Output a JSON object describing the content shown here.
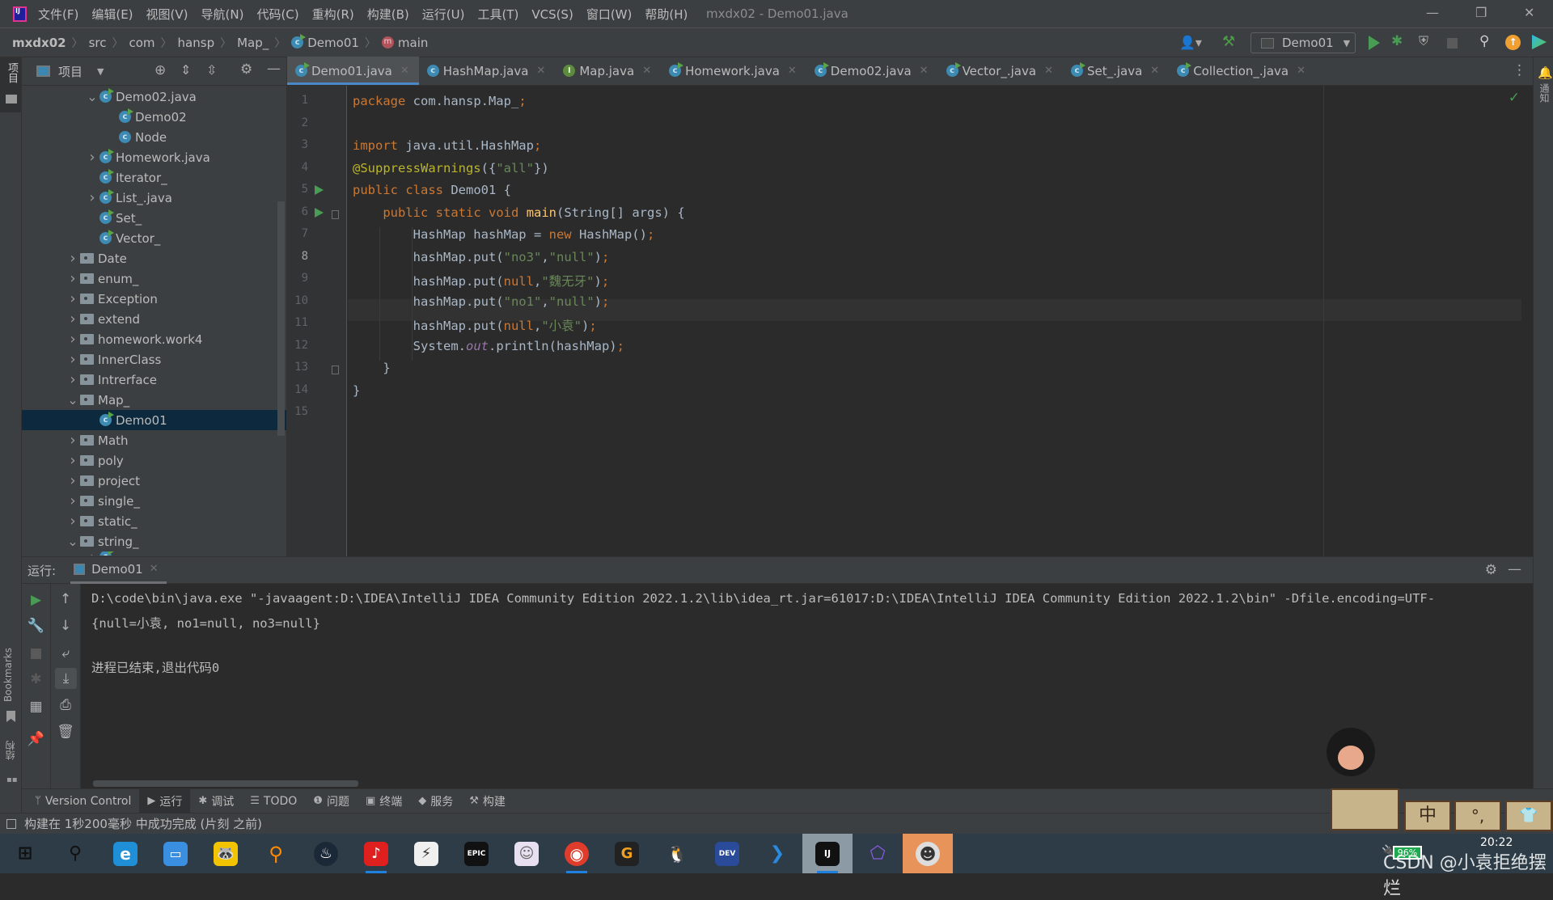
{
  "titlebar": {
    "window_title": "mxdx02 - Demo01.java",
    "menu": [
      "文件(F)",
      "编辑(E)",
      "视图(V)",
      "导航(N)",
      "代码(C)",
      "重构(R)",
      "构建(B)",
      "运行(U)",
      "工具(T)",
      "VCS(S)",
      "窗口(W)",
      "帮助(H)"
    ],
    "controls": {
      "minimize": "—",
      "restore": "❐",
      "close": "✕"
    }
  },
  "navbar": {
    "breadcrumb": [
      "mxdx02",
      "src",
      "com",
      "hansp",
      "Map_",
      "Demo01",
      "main"
    ],
    "run_config": "Demo01"
  },
  "project_panel": {
    "title": "项目",
    "tree": [
      {
        "label": "Demo02.java",
        "type": "class-file",
        "depth": 3,
        "expanded": true
      },
      {
        "label": "Demo02",
        "type": "class-run",
        "depth": 4
      },
      {
        "label": "Node",
        "type": "class",
        "depth": 4
      },
      {
        "label": "Homework.java",
        "type": "class-file",
        "depth": 3,
        "expanded": false
      },
      {
        "label": "Iterator_",
        "type": "class-run",
        "depth": 3
      },
      {
        "label": "List_.java",
        "type": "class-file",
        "depth": 3,
        "expanded": false
      },
      {
        "label": "Set_",
        "type": "class-run",
        "depth": 3
      },
      {
        "label": "Vector_",
        "type": "class-run",
        "depth": 3
      },
      {
        "label": "Date",
        "type": "package",
        "depth": 2,
        "expanded": false
      },
      {
        "label": "enum_",
        "type": "package",
        "depth": 2,
        "expanded": false
      },
      {
        "label": "Exception",
        "type": "package",
        "depth": 2,
        "expanded": false
      },
      {
        "label": "extend",
        "type": "package",
        "depth": 2,
        "expanded": false
      },
      {
        "label": "homework.work4",
        "type": "package",
        "depth": 2,
        "expanded": false
      },
      {
        "label": "InnerClass",
        "type": "package",
        "depth": 2,
        "expanded": false
      },
      {
        "label": "Intrerface",
        "type": "package",
        "depth": 2,
        "expanded": false
      },
      {
        "label": "Map_",
        "type": "package",
        "depth": 2,
        "expanded": true
      },
      {
        "label": "Demo01",
        "type": "class-run",
        "depth": 3,
        "selected": true
      },
      {
        "label": "Math",
        "type": "package",
        "depth": 2,
        "expanded": false
      },
      {
        "label": "poly",
        "type": "package",
        "depth": 2,
        "expanded": false
      },
      {
        "label": "project",
        "type": "package",
        "depth": 2,
        "expanded": false
      },
      {
        "label": "single_",
        "type": "package",
        "depth": 2,
        "expanded": false
      },
      {
        "label": "static_",
        "type": "package",
        "depth": 2,
        "expanded": false
      },
      {
        "label": "string_",
        "type": "package",
        "depth": 2,
        "expanded": true
      }
    ]
  },
  "editor": {
    "tabs": [
      {
        "label": "Demo01.java",
        "icon": "class-run",
        "active": true
      },
      {
        "label": "HashMap.java",
        "icon": "class"
      },
      {
        "label": "Map.java",
        "icon": "interface"
      },
      {
        "label": "Homework.java",
        "icon": "class-run"
      },
      {
        "label": "Demo02.java",
        "icon": "class-run"
      },
      {
        "label": "Vector_.java",
        "icon": "class-run"
      },
      {
        "label": "Set_.java",
        "icon": "class-run"
      },
      {
        "label": "Collection_.java",
        "icon": "class-run"
      }
    ],
    "current_line": 8,
    "lines": [
      "package com.hansp.Map_;",
      "",
      "import java.util.HashMap;",
      "@SuppressWarnings({\"all\"})",
      "public class Demo01 {",
      "    public static void main(String[] args) {",
      "        HashMap hashMap = new HashMap();",
      "        hashMap.put(\"no3\",\"null\");",
      "        hashMap.put(null,\"魏无牙\");",
      "        hashMap.put(\"no1\",\"null\");",
      "        hashMap.put(null,\"小袁\");",
      "        System.out.println(hashMap);",
      "    }",
      "}",
      ""
    ],
    "line_numbers": [
      "1",
      "2",
      "3",
      "4",
      "5",
      "6",
      "7",
      "8",
      "9",
      "10",
      "11",
      "12",
      "13",
      "14",
      "15"
    ]
  },
  "run_panel": {
    "label": "运行:",
    "tab": "Demo01",
    "output": [
      "D:\\code\\bin\\java.exe \"-javaagent:D:\\IDEA\\IntelliJ IDEA Community Edition 2022.1.2\\lib\\idea_rt.jar=61017:D:\\IDEA\\IntelliJ IDEA Community Edition 2022.1.2\\bin\" -Dfile.encoding=UTF-",
      "{null=小袁, no1=null, no3=null}",
      "",
      "进程已结束,退出代码0"
    ]
  },
  "bottom_toolbar": [
    {
      "label": "Version Control",
      "icon": "branch-icon"
    },
    {
      "label": "运行",
      "icon": "run-icon",
      "active": true
    },
    {
      "label": "调试",
      "icon": "debug-icon"
    },
    {
      "label": "TODO",
      "icon": "list-icon"
    },
    {
      "label": "问题",
      "icon": "problems-icon"
    },
    {
      "label": "终端",
      "icon": "terminal-icon"
    },
    {
      "label": "服务",
      "icon": "services-icon"
    },
    {
      "label": "构建",
      "icon": "build-icon"
    }
  ],
  "left_strip": {
    "project": "项目",
    "bookmarks": "Bookmarks",
    "structure": "结构"
  },
  "right_strip": {
    "notifications": "通知"
  },
  "statusbar": {
    "message": "构建在 1秒200毫秒 中成功完成 (片刻 之前)"
  },
  "taskbar": {
    "apps": [
      "start",
      "search",
      "edge",
      "explorer",
      "app-raccoon",
      "search-tool",
      "steam",
      "netease-music",
      "thunder",
      "epic-games",
      "anime-app",
      "chrome",
      "clock-app",
      "qq",
      "dev-cpp",
      "vscode",
      "intellij",
      "app-prism",
      "avatar-app"
    ],
    "clock": "20:22",
    "battery": "96%",
    "watermark": "CSDN @小袁拒绝摆烂"
  },
  "colors": {
    "accent": "#4a88c7",
    "run_green": "#499c54",
    "selection": "#0d293e"
  }
}
